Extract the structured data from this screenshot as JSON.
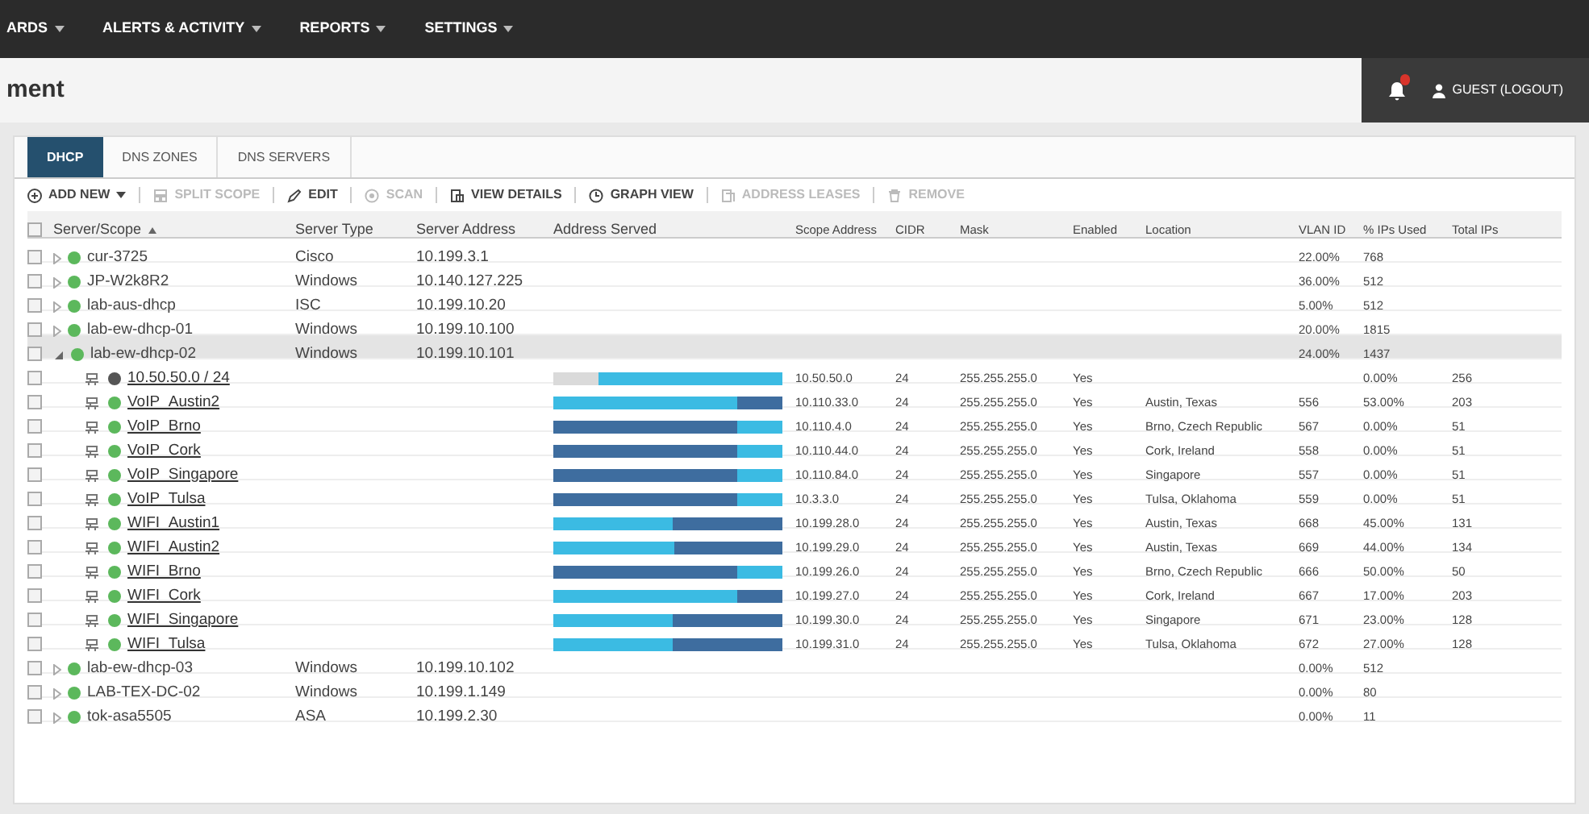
{
  "nav": {
    "items": [
      {
        "label": "ARDS"
      },
      {
        "label": "ALERTS & ACTIVITY"
      },
      {
        "label": "REPORTS"
      },
      {
        "label": "SETTINGS"
      }
    ]
  },
  "page_title": "ment",
  "user": {
    "label": "GUEST (LOGOUT)"
  },
  "tabs": [
    {
      "label": "DHCP",
      "selected": true
    },
    {
      "label": "DNS ZONES",
      "selected": false
    },
    {
      "label": "DNS SERVERS",
      "selected": false
    }
  ],
  "toolbar": [
    {
      "kind": "add",
      "label": "ADD NEW",
      "dropdown": true,
      "disabled": false
    },
    {
      "kind": "split",
      "label": "SPLIT SCOPE",
      "dropdown": false,
      "disabled": true
    },
    {
      "kind": "edit",
      "label": "EDIT",
      "dropdown": false,
      "disabled": false
    },
    {
      "kind": "scan",
      "label": "SCAN",
      "dropdown": false,
      "disabled": true
    },
    {
      "kind": "details",
      "label": "VIEW DETAILS",
      "dropdown": false,
      "disabled": false
    },
    {
      "kind": "graph",
      "label": "GRAPH VIEW",
      "dropdown": false,
      "disabled": false
    },
    {
      "kind": "leases",
      "label": "ADDRESS LEASES",
      "dropdown": false,
      "disabled": true
    },
    {
      "kind": "remove",
      "label": "REMOVE",
      "dropdown": false,
      "disabled": true
    }
  ],
  "table": {
    "header_checked": false,
    "columns": [
      {
        "label": "Server/Scope",
        "sorted": true
      },
      {
        "label": "Server Type",
        "sorted": false
      },
      {
        "label": "Server Address",
        "sorted": false
      },
      {
        "label": "Address Served",
        "sorted": false
      },
      {
        "label": "Scope Address",
        "sorted": false
      },
      {
        "label": "CIDR",
        "sorted": false
      },
      {
        "label": "Mask",
        "sorted": false
      },
      {
        "label": "Enabled",
        "sorted": false
      },
      {
        "label": "Location",
        "sorted": false
      },
      {
        "label": "VLAN ID",
        "sorted": false
      },
      {
        "label": "% IPs Used",
        "sorted": false
      },
      {
        "label": "Total IPs",
        "sorted": false
      }
    ],
    "rows": [
      {
        "name": "cur-3725",
        "type": "Cisco",
        "address": "10.199.3.1",
        "pct_used": "22.00%",
        "total_ips": "768",
        "checked": false,
        "expanded": false,
        "highlighted": false,
        "color": "#5cb85c"
      },
      {
        "name": "JP-W2k8R2",
        "type": "Windows",
        "address": "10.140.127.225",
        "pct_used": "36.00%",
        "total_ips": "512",
        "checked": false,
        "expanded": false,
        "highlighted": false,
        "color": "#5cb85c"
      },
      {
        "name": "lab-aus-dhcp",
        "type": "ISC",
        "address": "10.199.10.20",
        "pct_used": "5.00%",
        "total_ips": "512",
        "checked": false,
        "expanded": false,
        "highlighted": false,
        "color": "#5cb85c"
      },
      {
        "name": "lab-ew-dhcp-01",
        "type": "Windows",
        "address": "10.199.10.100",
        "pct_used": "20.00%",
        "total_ips": "1815",
        "checked": false,
        "expanded": false,
        "highlighted": false,
        "color": "#5cb85c"
      },
      {
        "name": "lab-ew-dhcp-02",
        "type": "Windows",
        "address": "10.199.10.101",
        "pct_used": "24.00%",
        "total_ips": "1437",
        "checked": false,
        "expanded": true,
        "highlighted": true,
        "color": "#5cb85c",
        "children": [
          {
            "name": "10.50.50.0 / 24",
            "color": "#555555",
            "checked": false,
            "bar": {
              "level": 0.2,
              "kind": "empty"
            },
            "scope_address": "10.50.50.0",
            "cidr": "24",
            "mask": "255.255.255.0",
            "enabled": "Yes",
            "pct_used": "0.00%",
            "total_ips": "256"
          },
          {
            "name": "VoIP_Austin2",
            "color": "#5cb85c",
            "checked": false,
            "bar": {
              "level": 0.8,
              "kind": "light"
            },
            "scope_address": "10.110.33.0",
            "cidr": "24",
            "mask": "255.255.255.0",
            "enabled": "Yes",
            "location": "Austin, Texas",
            "vlan_id": "556",
            "pct_used": "53.00%",
            "total_ips": "203"
          },
          {
            "name": "VoIP_Brno",
            "color": "#5cb85c",
            "checked": false,
            "bar": {
              "level": 0.8,
              "kind": "dark"
            },
            "scope_address": "10.110.4.0",
            "cidr": "24",
            "mask": "255.255.255.0",
            "enabled": "Yes",
            "location": "Brno, Czech Republic",
            "vlan_id": "567",
            "pct_used": "0.00%",
            "total_ips": "51"
          },
          {
            "name": "VoIP_Cork",
            "color": "#5cb85c",
            "checked": false,
            "bar": {
              "level": 0.8,
              "kind": "dark"
            },
            "scope_address": "10.110.44.0",
            "cidr": "24",
            "mask": "255.255.255.0",
            "enabled": "Yes",
            "location": "Cork, Ireland",
            "vlan_id": "558",
            "pct_used": "0.00%",
            "total_ips": "51"
          },
          {
            "name": "VoIP_Singapore",
            "color": "#5cb85c",
            "checked": false,
            "bar": {
              "level": 0.8,
              "kind": "dark"
            },
            "scope_address": "10.110.84.0",
            "cidr": "24",
            "mask": "255.255.255.0",
            "enabled": "Yes",
            "location": "Singapore",
            "vlan_id": "557",
            "pct_used": "0.00%",
            "total_ips": "51"
          },
          {
            "name": "VoIP_Tulsa",
            "color": "#5cb85c",
            "checked": false,
            "bar": {
              "level": 0.8,
              "kind": "dark"
            },
            "scope_address": "10.3.3.0",
            "cidr": "24",
            "mask": "255.255.255.0",
            "enabled": "Yes",
            "location": "Tulsa, Oklahoma",
            "vlan_id": "559",
            "pct_used": "0.00%",
            "total_ips": "51"
          },
          {
            "name": "WIFI_Austin1",
            "color": "#5cb85c",
            "checked": false,
            "bar": {
              "level": 0.52,
              "kind": "light"
            },
            "scope_address": "10.199.28.0",
            "cidr": "24",
            "mask": "255.255.255.0",
            "enabled": "Yes",
            "location": "Austin, Texas",
            "vlan_id": "668",
            "pct_used": "45.00%",
            "total_ips": "131"
          },
          {
            "name": "WIFI_Austin2",
            "color": "#5cb85c",
            "checked": false,
            "bar": {
              "level": 0.53,
              "kind": "light"
            },
            "scope_address": "10.199.29.0",
            "cidr": "24",
            "mask": "255.255.255.0",
            "enabled": "Yes",
            "location": "Austin, Texas",
            "vlan_id": "669",
            "pct_used": "44.00%",
            "total_ips": "134"
          },
          {
            "name": "WIFI_Brno",
            "color": "#5cb85c",
            "checked": false,
            "bar": {
              "level": 0.8,
              "kind": "dark"
            },
            "scope_address": "10.199.26.0",
            "cidr": "24",
            "mask": "255.255.255.0",
            "enabled": "Yes",
            "location": "Brno, Czech Republic",
            "vlan_id": "666",
            "pct_used": "50.00%",
            "total_ips": "50"
          },
          {
            "name": "WIFI_Cork",
            "color": "#5cb85c",
            "checked": false,
            "bar": {
              "level": 0.8,
              "kind": "light"
            },
            "scope_address": "10.199.27.0",
            "cidr": "24",
            "mask": "255.255.255.0",
            "enabled": "Yes",
            "location": "Cork, Ireland",
            "vlan_id": "667",
            "pct_used": "17.00%",
            "total_ips": "203"
          },
          {
            "name": "WIFI_Singapore",
            "color": "#5cb85c",
            "checked": false,
            "bar": {
              "level": 0.52,
              "kind": "light"
            },
            "scope_address": "10.199.30.0",
            "cidr": "24",
            "mask": "255.255.255.0",
            "enabled": "Yes",
            "location": "Singapore",
            "vlan_id": "671",
            "pct_used": "23.00%",
            "total_ips": "128"
          },
          {
            "name": "WIFI_Tulsa",
            "color": "#5cb85c",
            "checked": false,
            "bar": {
              "level": 0.52,
              "kind": "light"
            },
            "scope_address": "10.199.31.0",
            "cidr": "24",
            "mask": "255.255.255.0",
            "enabled": "Yes",
            "location": "Tulsa, Oklahoma",
            "vlan_id": "672",
            "pct_used": "27.00%",
            "total_ips": "128"
          }
        ]
      },
      {
        "name": "lab-ew-dhcp-03",
        "type": "Windows",
        "address": "10.199.10.102",
        "pct_used": "0.00%",
        "total_ips": "512",
        "checked": false,
        "expanded": false,
        "highlighted": false,
        "color": "#5cb85c"
      },
      {
        "name": "LAB-TEX-DC-02",
        "type": "Windows",
        "address": "10.199.1.149",
        "pct_used": "0.00%",
        "total_ips": "80",
        "checked": false,
        "expanded": false,
        "highlighted": false,
        "color": "#5cb85c"
      },
      {
        "name": "tok-asa5505",
        "type": "ASA",
        "address": "10.199.2.30",
        "pct_used": "0.00%",
        "total_ips": "11",
        "checked": false,
        "expanded": false,
        "highlighted": false,
        "color": "#5cb85c"
      }
    ]
  }
}
